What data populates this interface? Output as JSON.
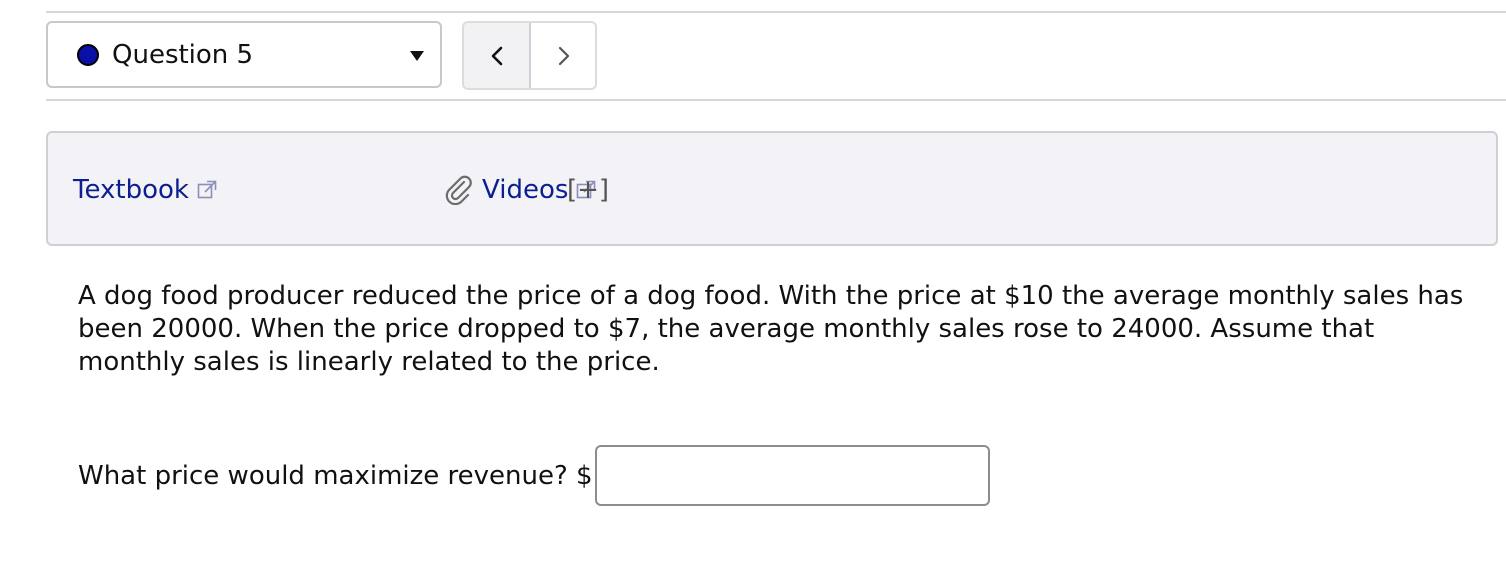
{
  "header": {
    "question_select": {
      "label": "Question 5",
      "status_color": "#0a10a6"
    },
    "nav": {
      "prev_icon": "chevron-left-icon",
      "next_icon": "chevron-right-icon"
    }
  },
  "resources": {
    "textbook_label": "Textbook",
    "videos_label": "Videos",
    "expand_label": "[+]"
  },
  "problem": {
    "text": "A dog food producer reduced the price of a dog food. With the price at $10 the average monthly sales has been 20000. When the price dropped to $7, the average monthly sales rose to 24000. Assume that monthly sales is linearly related to the price.",
    "prompt": "What price would maximize revenue? $",
    "answer_value": ""
  },
  "colors": {
    "link": "#0b1f8f",
    "panel_bg": "#f2f2f7",
    "status_dot": "#0a10a6"
  }
}
